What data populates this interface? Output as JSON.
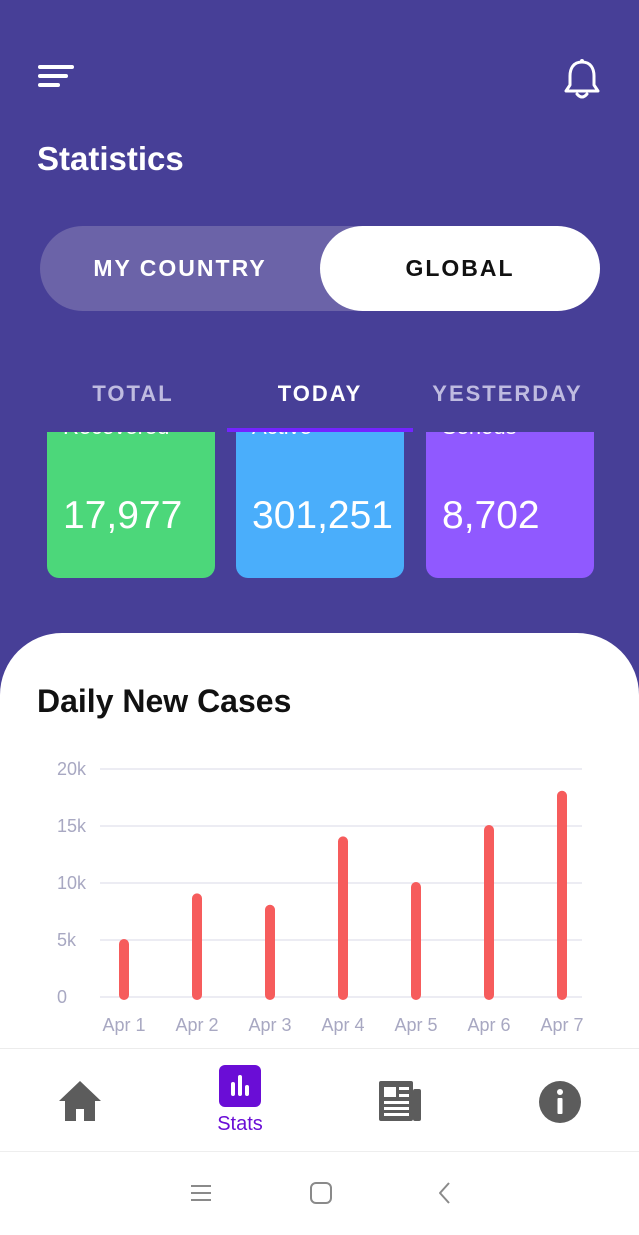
{
  "header": {
    "title": "Statistics"
  },
  "scope_toggle": {
    "my_country": "MY COUNTRY",
    "global": "GLOBAL",
    "selected": "GLOBAL"
  },
  "tabs": [
    {
      "label": "TOTAL"
    },
    {
      "label": "TODAY"
    },
    {
      "label": "YESTERDAY"
    }
  ],
  "selected_tab": "TODAY",
  "cards": [
    {
      "label": "Recovered",
      "value": "17,977",
      "color": "#4cd77a"
    },
    {
      "label": "Active",
      "value": "301,251",
      "color": "#4aaefb"
    },
    {
      "label": "Serious",
      "value": "8,702",
      "color": "#9059ff"
    }
  ],
  "chart_section": {
    "title": "Daily New Cases"
  },
  "chart_data": {
    "type": "bar",
    "title": "Daily New Cases",
    "categories": [
      "Apr 1",
      "Apr 2",
      "Apr 3",
      "Apr 4",
      "Apr 5",
      "Apr 6",
      "Apr 7"
    ],
    "values": [
      5000,
      9000,
      8000,
      14000,
      10000,
      15000,
      18000
    ],
    "yticks": [
      "0",
      "5k",
      "10k",
      "15k",
      "20k"
    ],
    "ylim": [
      0,
      20000
    ],
    "grid": true,
    "bar_color": "#f65c5c"
  },
  "bottom_nav": {
    "items": [
      {
        "name": "home",
        "icon": "home-icon"
      },
      {
        "name": "stats",
        "icon": "bar-chart-icon",
        "label": "Stats"
      },
      {
        "name": "news",
        "icon": "newspaper-icon"
      },
      {
        "name": "info",
        "icon": "info-icon"
      }
    ],
    "active": "stats"
  },
  "colors": {
    "header_bg": "#473f97",
    "accent": "#6a0dd6",
    "tab_indicator": "#7424ff"
  }
}
